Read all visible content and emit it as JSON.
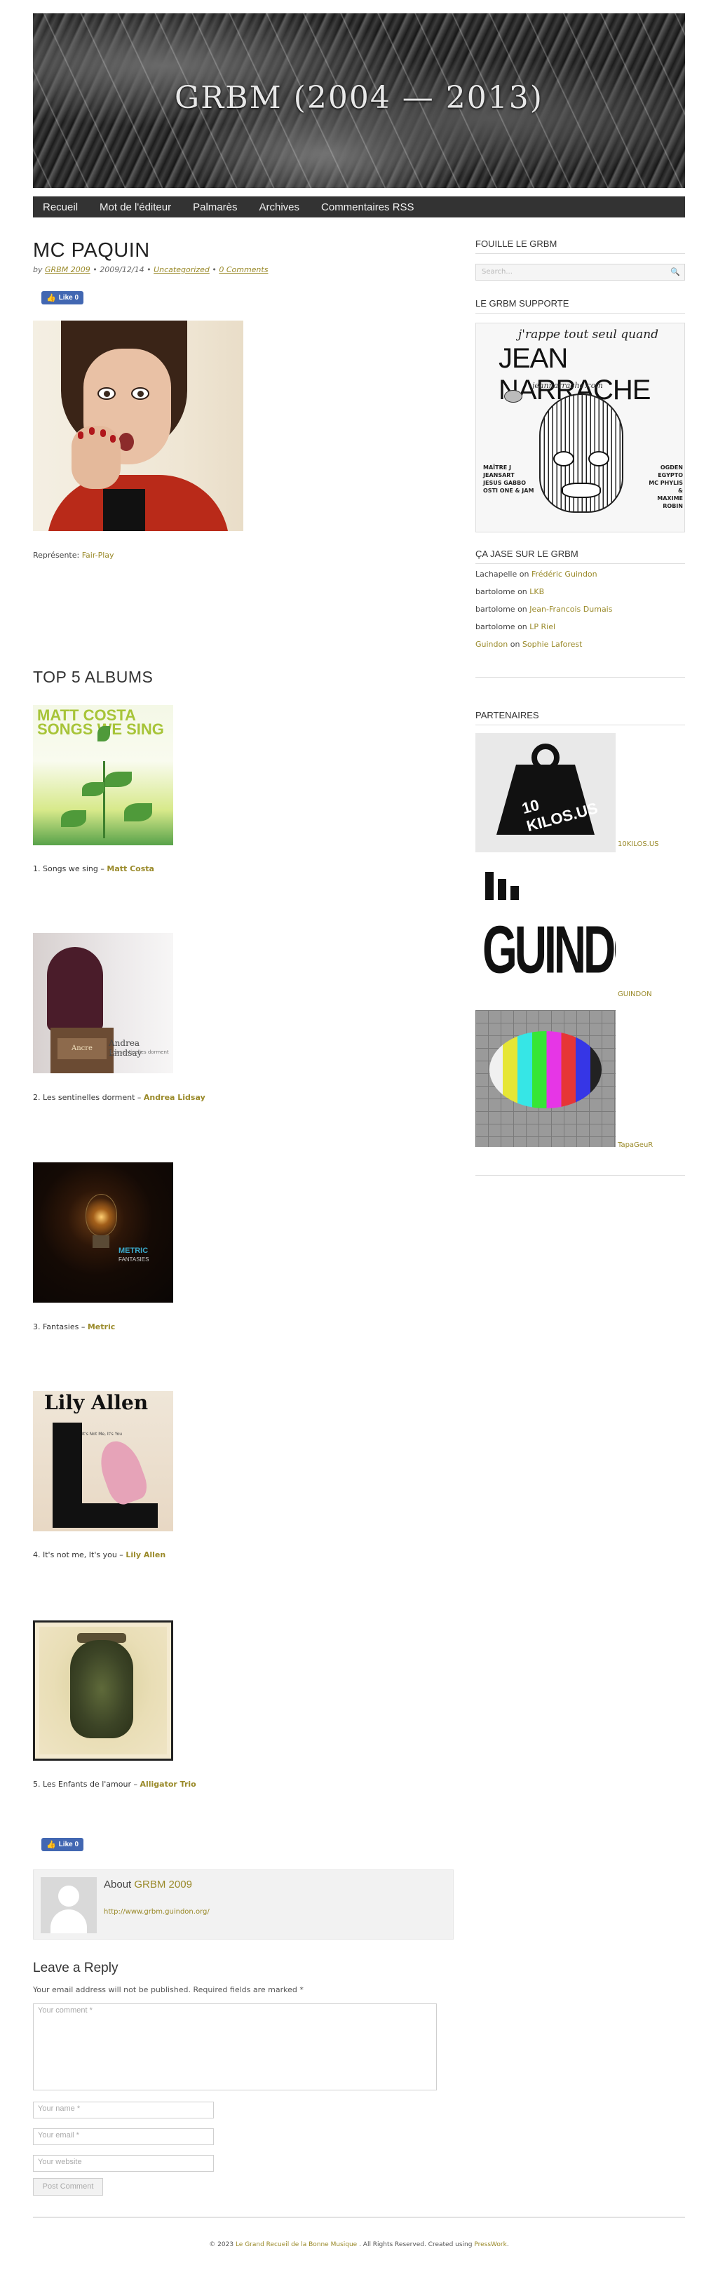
{
  "site": {
    "title": "GRBM (2004 — 2013)"
  },
  "nav": [
    "Recueil",
    "Mot de l'éditeur",
    "Palmarès",
    "Archives",
    "Commentaires RSS"
  ],
  "post": {
    "title": "MC PAQUIN",
    "meta": {
      "by": "by",
      "author": "GRBM 2009",
      "date": "2009/12/14",
      "category": "Uncategorized",
      "comments": "0 Comments",
      "sep": "•"
    },
    "like_label": "Like 0",
    "represent_label": "Représente:",
    "represent_link": "Fair-Play"
  },
  "top5": {
    "title": "TOP 5 ALBUMS",
    "albums": [
      {
        "caption": "1. Songs we sing –",
        "artist": "Matt Costa",
        "cover_text": "MATT COSTA SONGS WE SING"
      },
      {
        "caption": "2. Les sentinelles dorment –",
        "artist": "Andrea Lidsay",
        "cover_text": "Andrea Lindsay",
        "cover_sub": "Les sentinelles dorment",
        "cover_sign": "Ancre"
      },
      {
        "caption": "3. Fantasies –",
        "artist": "Metric",
        "cover_text": "METRIC",
        "cover_sub": "FANTASIES"
      },
      {
        "caption": "4. It's not me, It's you –",
        "artist": "Lily Allen",
        "cover_text": "Lily Allen",
        "cover_sub": "It's Not Me, It's You"
      },
      {
        "caption": "5. Les Enfants de l'amour –",
        "artist": "Alligator Trio"
      }
    ]
  },
  "author": {
    "about_prefix": "About",
    "name": "GRBM 2009",
    "url": "http://www.grbm.guindon.org/"
  },
  "reply": {
    "title": "Leave a Reply",
    "note": "Your email address will not be published. Required fields are marked *",
    "comment_placeholder": "Your comment *",
    "name_placeholder": "Your name *",
    "email_placeholder": "Your email *",
    "website_placeholder": "Your website",
    "submit_label": "Post Comment"
  },
  "footer": {
    "prefix": "© 2023",
    "site_link": "Le Grand Recueil de la Bonne Musique",
    "middle": ". All Rights Reserved. Created using",
    "theme_link": "PressWork",
    "suffix": "."
  },
  "sidebar": {
    "search_title": "FOUILLE LE GRBM",
    "search_placeholder": "Search...",
    "support_title": "LE GRBM SUPPORTE",
    "support_banner": {
      "top": "j'rappe tout seul quand",
      "name": "JEAN NARRACHE",
      "url": "jeannarrache.com",
      "left": [
        "MAÎTRE J",
        "JEANSART",
        "JESUS GABBO",
        "OSTI ONE & JAM"
      ],
      "right": [
        "OGDEN",
        "EGYPTO",
        "MC PHYLIS &",
        "MAXIME ROBIN"
      ]
    },
    "recent_title": "ÇA JASE SUR LE GRBM",
    "recent": [
      {
        "author": "Lachapelle",
        "on": "on",
        "post": "Frédéric Guindon",
        "author_link": false
      },
      {
        "author": "bartolome",
        "on": "on",
        "post": "LKB",
        "author_link": false
      },
      {
        "author": "bartolome",
        "on": "on",
        "post": "Jean-Francois Dumais",
        "author_link": false
      },
      {
        "author": "bartolome",
        "on": "on",
        "post": "LP Riel",
        "author_link": false
      },
      {
        "author": "Guindon",
        "on": "on",
        "post": "Sophie Laforest",
        "author_link": true
      }
    ],
    "partners_title": "PARTENAIRES",
    "partners": [
      {
        "label": "10KILOS.US",
        "img_text": "10 KILOS.US"
      },
      {
        "label": "GUINDON",
        "img_text": "GUINDON"
      },
      {
        "label": "TapaGeuR"
      }
    ]
  },
  "colors": {
    "link": "#9a8a2a",
    "nav_bg": "#333333",
    "fb": "#4267b2"
  }
}
